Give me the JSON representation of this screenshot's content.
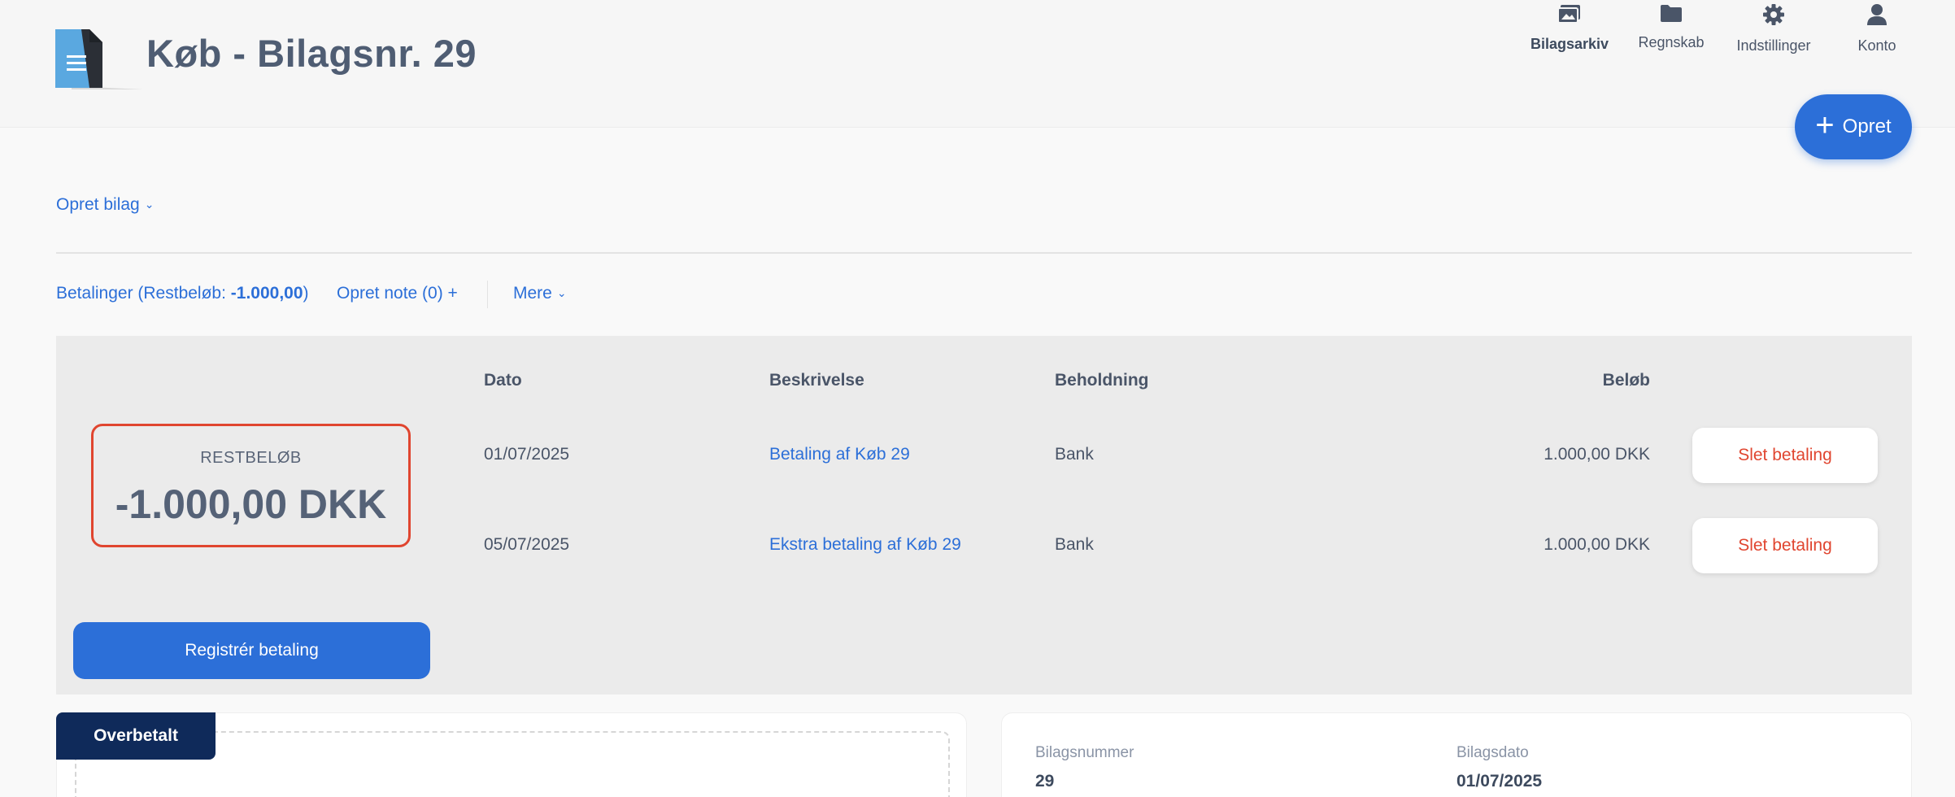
{
  "header": {
    "title": "Køb - Bilagsnr. 29",
    "nav": [
      {
        "label": "Bilagsarkiv",
        "icon": "photo-archive-icon"
      },
      {
        "label": "Regnskab",
        "icon": "folder-icon"
      },
      {
        "label": "Indstillinger",
        "icon": "gear-icon"
      },
      {
        "label": "Konto",
        "icon": "user-icon"
      }
    ],
    "create_label": "Opret"
  },
  "opret_bilag": "Opret bilag",
  "tabs": {
    "payments_prefix": "Betalinger (Restbeløb: ",
    "payments_amount": "-1.000,00",
    "payments_suffix": ")",
    "note": "Opret note (0) +",
    "more": "Mere"
  },
  "remaining": {
    "label": "RESTBELØB",
    "value": "-1.000,00 DKK"
  },
  "payments_table": {
    "headers": [
      "Dato",
      "Beskrivelse",
      "Beholdning",
      "Beløb"
    ],
    "rows": [
      {
        "date": "01/07/2025",
        "description": "Betaling af Køb 29",
        "account": "Bank",
        "amount": "1.000,00 DKK",
        "action": "Slet betaling"
      },
      {
        "date": "05/07/2025",
        "description": "Ekstra betaling af Køb 29",
        "account": "Bank",
        "amount": "1.000,00 DKK",
        "action": "Slet betaling"
      }
    ]
  },
  "register_payment": "Registrér betaling",
  "status_tag": "Overbetalt",
  "details": {
    "voucher_number_label": "Bilagsnummer",
    "voucher_number": "29",
    "voucher_date_label": "Bilagsdato",
    "voucher_date": "01/07/2025"
  },
  "colors": {
    "accent": "#2c6fd8",
    "danger": "#e0452f",
    "status_dark": "#0f2a5a"
  }
}
